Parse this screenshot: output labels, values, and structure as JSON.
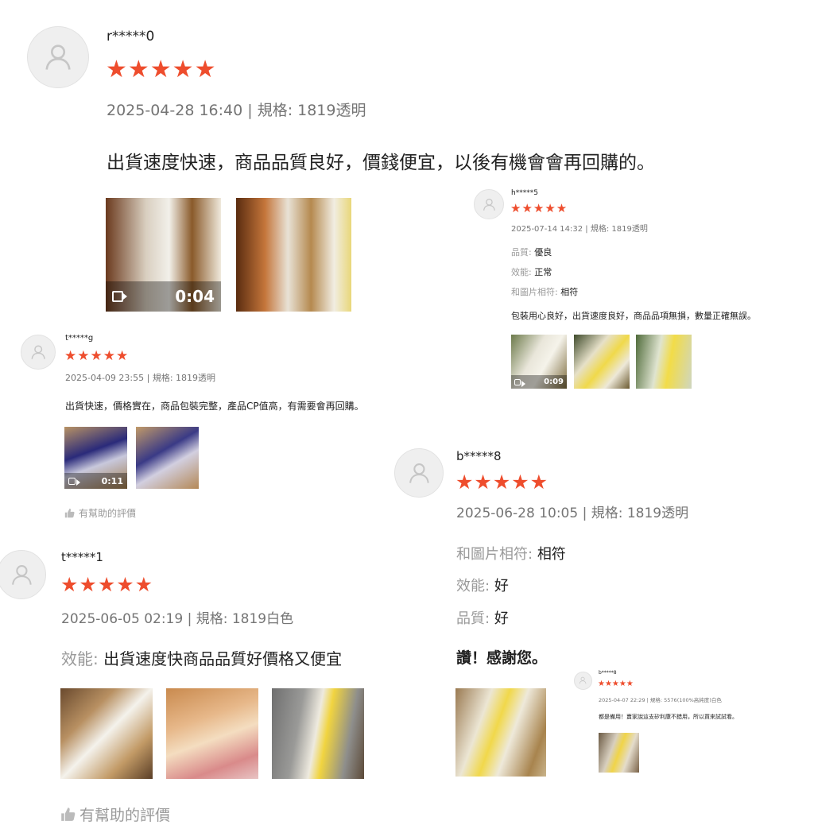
{
  "reviews": [
    {
      "user": "r*****0",
      "stars": "★★★★★",
      "meta": "2025-04-28 16:40 | 規格: 1819透明",
      "text": "出貨速度快速，商品品質良好，價錢便宜，以後有機會會再回購的。",
      "video_duration": "0:04"
    },
    {
      "user": "h*****5",
      "stars": "★★★★★",
      "meta": "2025-07-14 14:32 | 規格: 1819透明",
      "attributes": [
        {
          "key": "品質:",
          "value": "優良"
        },
        {
          "key": "效能:",
          "value": "正常"
        },
        {
          "key": "和圖片相符:",
          "value": "相符"
        }
      ],
      "text": "包裝用心良好，出貨速度良好，商品品項無損，數量正確無誤。",
      "video_duration": "0:09"
    },
    {
      "user": "t*****g",
      "stars": "★★★★★",
      "meta": "2025-04-09 23:55 | 規格: 1819透明",
      "text": "出貨快速，價格實在，商品包裝完整，產品CP值高，有需要會再回購。",
      "video_duration": "0:11",
      "helpful": "有幫助的評價"
    },
    {
      "user": "b*****8",
      "stars": "★★★★★",
      "meta": "2025-06-28 10:05 | 規格: 1819透明",
      "attributes": [
        {
          "key": "和圖片相符:",
          "value": "相符"
        },
        {
          "key": "效能:",
          "value": "好"
        },
        {
          "key": "品質:",
          "value": "好"
        }
      ],
      "text": "讚！感謝您。"
    },
    {
      "user": "t*****1",
      "stars": "★★★★★",
      "meta": "2025-06-05 02:19 | 規格: 1819白色",
      "attributes": [
        {
          "key": "效能:",
          "value": "出貨速度快商品品質好價格又便宜"
        }
      ],
      "helpful": "有幫助的評價"
    },
    {
      "user": "b*****8",
      "stars": "★★★★★",
      "meta": "2025-04-07 22:29 | 規格: 5576(100%高純度)白色",
      "text": "都是備用！賣家說這支矽利康不錯用，所以買來試試看。"
    }
  ],
  "colors": {
    "star": "#ee4d2d",
    "meta": "#757575",
    "label": "#9a9a9a"
  },
  "icons": {
    "avatar": "user-icon",
    "video": "video-camera-icon",
    "helpful": "thumbs-up-icon"
  }
}
